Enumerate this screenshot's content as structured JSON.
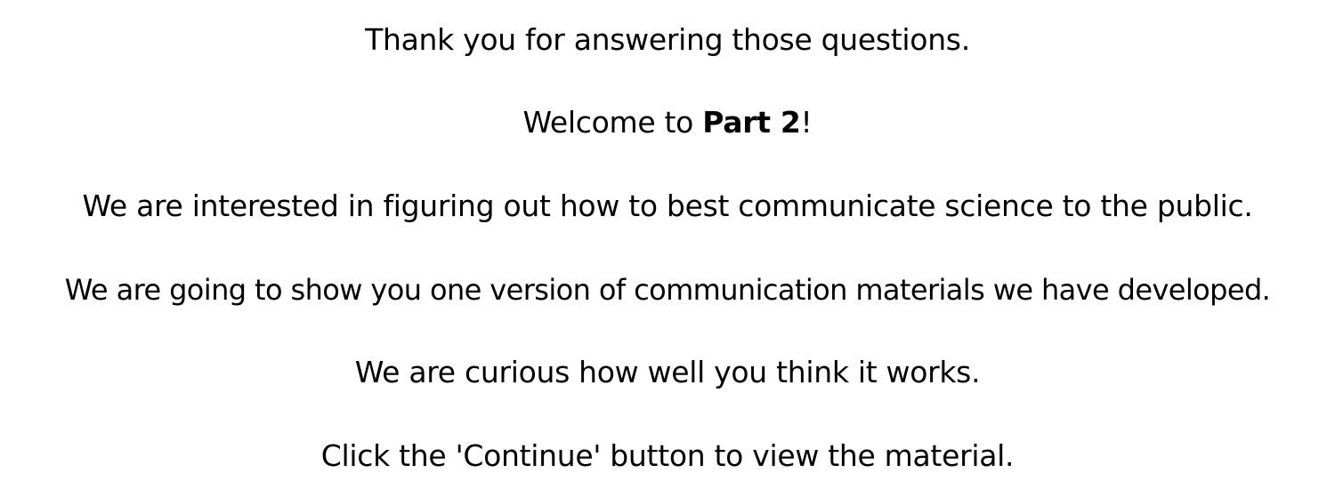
{
  "intro": {
    "thanks": "Thank you for answering those questions.",
    "welcome_prefix": "Welcome to ",
    "welcome_bold": "Part 2",
    "welcome_suffix": "!",
    "interest": "We are interested in figuring out how to best communicate science to the public.",
    "show": "We are going to show you one version of communication materials we have developed.",
    "curious": "We are curious how well you think it works.",
    "instruction": "Click the 'Continue' button to view the material."
  }
}
